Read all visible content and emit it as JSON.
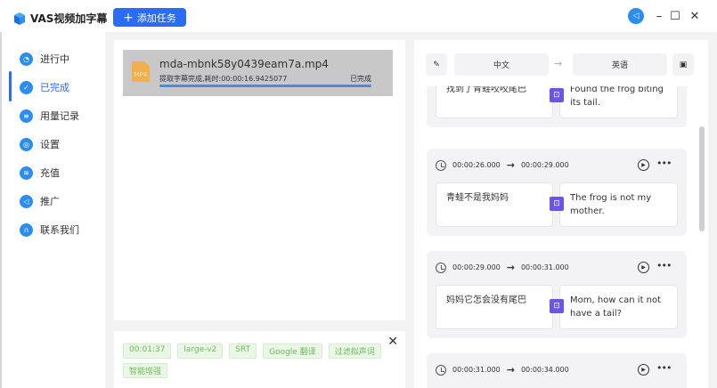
{
  "app": {
    "title": "VAS视频加字幕",
    "add_task": "添加任务"
  },
  "sidebar": {
    "items": [
      {
        "label": "进行中",
        "icon": "clock-icon"
      },
      {
        "label": "已完成",
        "icon": "check-icon"
      },
      {
        "label": "用量记录",
        "icon": "list-icon"
      },
      {
        "label": "设置",
        "icon": "gear-icon"
      },
      {
        "label": "充值",
        "icon": "coins-icon"
      },
      {
        "label": "推广",
        "icon": "megaphone-icon"
      },
      {
        "label": "联系我们",
        "icon": "headset-icon"
      }
    ],
    "active": "已完成"
  },
  "task": {
    "icon_label": "MP4",
    "filename": "mda-mbnk58y0439eam7a.mp4",
    "status_text": "提取字幕完成,耗时:00:00:16.9425077",
    "status": "已完成",
    "progress": 100
  },
  "tags": [
    "00:01:37",
    "large-v2",
    "SRT",
    "Google 翻译",
    "过滤拟声词",
    "智能增强"
  ],
  "editor": {
    "source_lang": "中文",
    "target_lang": "英语",
    "arrow": "→",
    "segments": [
      {
        "start": "",
        "end": "",
        "source": "找到了青蛙咬咬尾巴",
        "target": "Found the frog biting its tail."
      },
      {
        "start": "00:00:26.000",
        "end": "00:00:29.000",
        "source": "青蛙不是我妈妈",
        "target": "The frog is not my mother."
      },
      {
        "start": "00:00:29.000",
        "end": "00:00:31.000",
        "source": "妈妈它怎会没有尾巴",
        "target": "Mom, how can it not have a tail?"
      },
      {
        "start": "00:00:31.000",
        "end": "00:00:34.000",
        "source": "",
        "target": ""
      }
    ]
  },
  "colors": {
    "primary": "#2a6cf5",
    "tag_green": "#6dbb5a",
    "bot": "#6a55e8"
  }
}
